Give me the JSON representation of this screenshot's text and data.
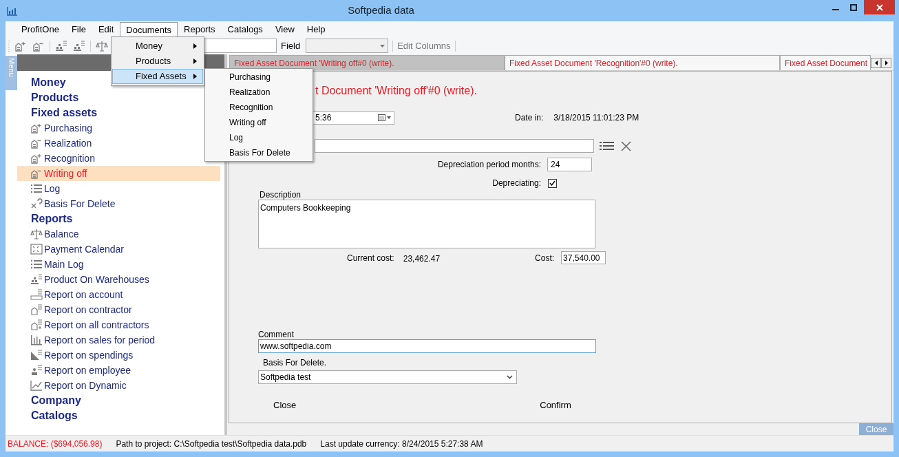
{
  "window": {
    "title": "Softpedia data"
  },
  "menu_bar": [
    {
      "label": "ProfitOne",
      "selected": false
    },
    {
      "label": "File",
      "selected": false
    },
    {
      "label": "Edit",
      "selected": false
    },
    {
      "label": "Documents",
      "selected": true
    },
    {
      "label": "Reports",
      "selected": false
    },
    {
      "label": "Catalogs",
      "selected": false
    },
    {
      "label": "View",
      "selected": false
    },
    {
      "label": "Help",
      "selected": false
    }
  ],
  "toolbar": {
    "field_label": "Field",
    "edit_columns": "Edit Columns"
  },
  "open_menu": {
    "items": [
      {
        "label": "Money",
        "selected": false
      },
      {
        "label": "Products",
        "selected": false
      },
      {
        "label": "Fixed Assets",
        "selected": true
      }
    ]
  },
  "submenu": {
    "items": [
      "Purchasing",
      "Realization",
      "Recognition",
      "Writing off",
      "Log",
      "Basis For Delete"
    ]
  },
  "sidebar": {
    "tab_label": "Menu",
    "sections": [
      {
        "label": "Money"
      },
      {
        "label": "Products"
      },
      {
        "label": "Fixed assets",
        "children": [
          {
            "label": "Purchasing",
            "selected": false
          },
          {
            "label": "Realization",
            "selected": false
          },
          {
            "label": "Recognition",
            "selected": false
          },
          {
            "label": "Writing off",
            "selected": true
          },
          {
            "label": "Log",
            "selected": false
          },
          {
            "label": "Basis For Delete",
            "selected": false
          }
        ]
      },
      {
        "label": "Reports",
        "children": [
          {
            "label": "Balance",
            "selected": false
          },
          {
            "label": "Payment Calendar",
            "selected": false
          },
          {
            "label": "Main Log",
            "selected": false
          },
          {
            "label": "Product On Warehouses",
            "selected": false
          },
          {
            "label": "Report on account",
            "selected": false
          },
          {
            "label": "Report on contractor",
            "selected": false
          },
          {
            "label": "Report on all contractors",
            "selected": false
          },
          {
            "label": "Report on sales for period",
            "selected": false
          },
          {
            "label": "Report on spendings",
            "selected": false
          },
          {
            "label": "Report on employee",
            "selected": false
          },
          {
            "label": "Report on Dynamic",
            "selected": false
          }
        ]
      },
      {
        "label": "Company"
      },
      {
        "label": "Catalogs"
      }
    ]
  },
  "tabs": [
    {
      "label": "Fixed Asset Document 'Writing off#0 (write).",
      "selected": true
    },
    {
      "label": "Fixed Asset Document 'Recognition'#0 (write).",
      "selected": false
    },
    {
      "label": "Fixed Asset Document",
      "selected": false
    }
  ],
  "form": {
    "title": "t Document 'Writing off'#0 (write).",
    "date_value": "5:36",
    "date_in_label": "Date in:",
    "date_in_value": "3/18/2015 11:01:23 PM",
    "depreciation_label": "Depreciation period months:",
    "depreciation_value": "24",
    "depreciating_label": "Depreciating:",
    "depreciating_checked": true,
    "description_label": "Description",
    "description_value": "Computers Bookkeeping",
    "current_cost_label": "Current cost:",
    "current_cost_value": "23,462.47",
    "cost_label": "Cost:",
    "cost_value": "37,540.00",
    "comment_label": "Comment",
    "comment_value": "www.softpedia.com",
    "basis_label": "Basis For Delete.",
    "basis_value": "Softpedia test",
    "buttons": [
      "Close",
      "Confirm"
    ]
  },
  "panel_close": "Close",
  "status_bar": {
    "balance": "BALANCE: ($694,056.98)",
    "path": "Path to project: C:\\Softpedia test\\Softpedia data.pdb",
    "last_update": "Last update currency: 8/24/2015 5:27:38 AM"
  }
}
